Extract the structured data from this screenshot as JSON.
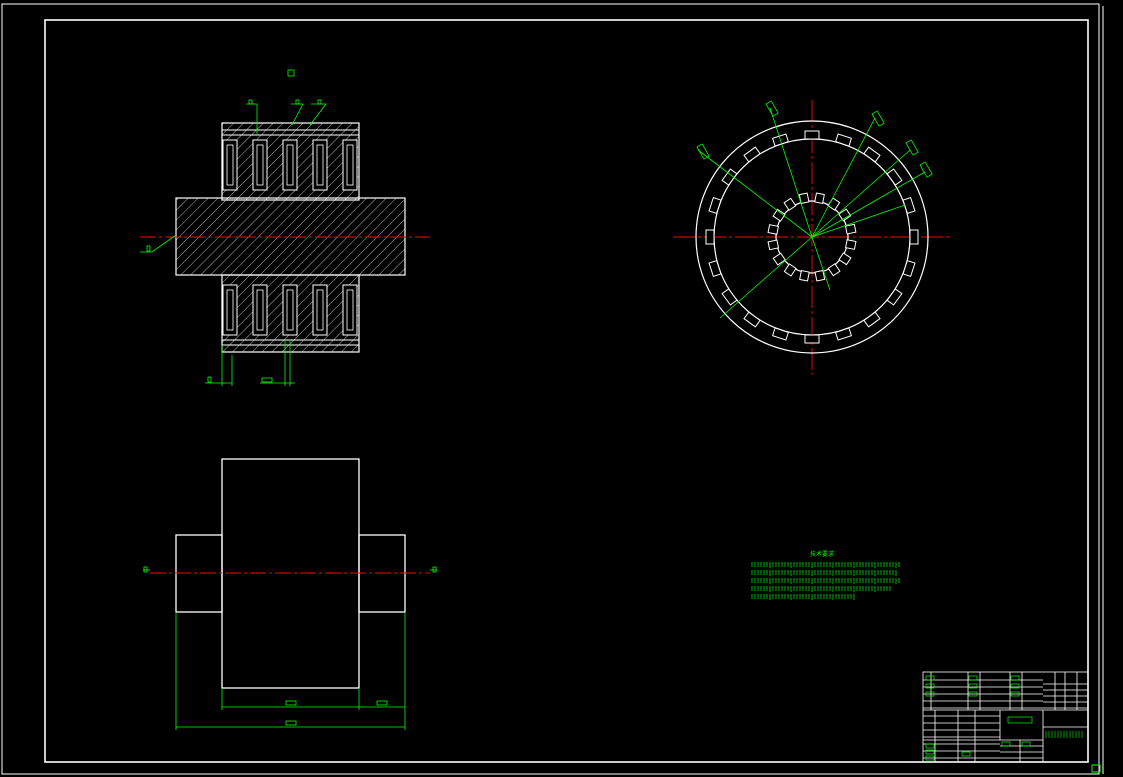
{
  "drawing": {
    "background_color": "#000000",
    "outline_color": "#ffffff",
    "dimension_color": "#00ff00",
    "centerline_color": "#ff0000",
    "tech_requirements_title": "技术要求"
  },
  "views": [
    {
      "name": "front-section-view"
    },
    {
      "name": "end-view"
    },
    {
      "name": "top-view"
    }
  ],
  "end_view": {
    "outer_slots": 20,
    "inner_teeth": 16
  }
}
